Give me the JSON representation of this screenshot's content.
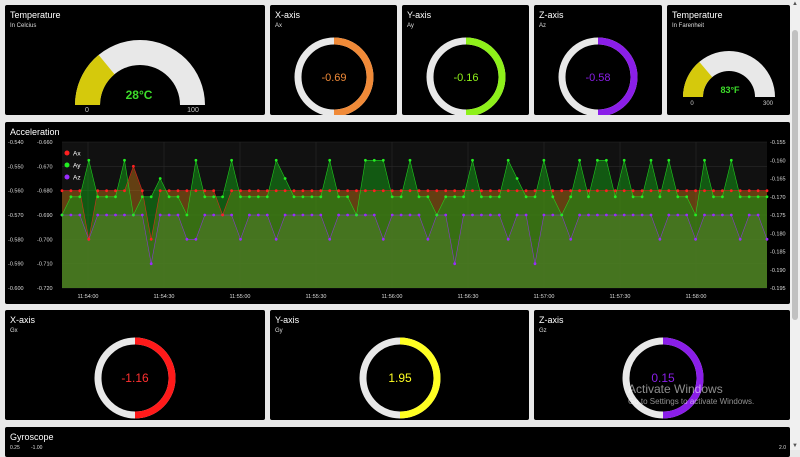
{
  "gauges": {
    "temp_c": {
      "title": "Temperature",
      "subtitle": "In Celcius",
      "value_text": "28°C",
      "min": "0",
      "max": "100",
      "value": 28,
      "range": [
        0,
        100
      ],
      "color": "#d5c90c",
      "value_color": "#3ddc2a"
    },
    "ax": {
      "title": "X-axis",
      "subtitle": "Ax",
      "value_text": "-0.69",
      "color": "#f08a38"
    },
    "ay": {
      "title": "Y-axis",
      "subtitle": "Ay",
      "value_text": "-0.16",
      "color": "#8ef01a"
    },
    "az": {
      "title": "Z-axis",
      "subtitle": "Az",
      "value_text": "-0.58",
      "color": "#8a1ee8"
    },
    "temp_f": {
      "title": "Temperature",
      "subtitle": "In Farenheit",
      "value_text": "83°F",
      "min": "0",
      "max": "300",
      "value": 83,
      "range": [
        0,
        300
      ],
      "color": "#d5c90c",
      "value_color": "#3ddc2a"
    },
    "gx": {
      "title": "X-axis",
      "subtitle": "Gx",
      "value_text": "-1.16",
      "color": "#ff1a1a"
    },
    "gy": {
      "title": "Y-axis",
      "subtitle": "Gy",
      "value_text": "1.95",
      "color": "#ffff22"
    },
    "gz": {
      "title": "Z-axis",
      "subtitle": "Gz",
      "value_text": "0.15",
      "color": "#8a1ee8"
    }
  },
  "chart_data": {
    "type": "area",
    "title": "Acceleration",
    "x_ticks": [
      "11:54:00",
      "11:54:30",
      "11:55:00",
      "11:55:30",
      "11:56:00",
      "11:56:30",
      "11:57:00",
      "11:57:30",
      "11:58:00"
    ],
    "y_left_outer_ticks": [
      "-0.540",
      "-0.550",
      "-0.560",
      "-0.570",
      "-0.580",
      "-0.590",
      "-0.600"
    ],
    "y_left_inner_ticks": [
      "-0.660",
      "-0.670",
      "-0.680",
      "-0.690",
      "-0.700",
      "-0.710",
      "-0.720"
    ],
    "y_right_ticks": [
      "-0.155",
      "-0.160",
      "-0.165",
      "-0.170",
      "-0.175",
      "-0.180",
      "-0.185",
      "-0.190",
      "-0.195"
    ],
    "ylim_ax": [
      -0.72,
      -0.66
    ],
    "ylim_az": [
      -0.6,
      -0.54
    ],
    "ylim_ay": [
      -0.195,
      -0.155
    ],
    "series": [
      {
        "name": "Ax",
        "color": "#ff2020",
        "fill": "rgba(200,120,20,0.45)",
        "values": [
          -0.68,
          -0.68,
          -0.68,
          -0.7,
          -0.68,
          -0.68,
          -0.68,
          -0.68,
          -0.67,
          -0.68,
          -0.7,
          -0.68,
          -0.68,
          -0.68,
          -0.68,
          -0.68,
          -0.68,
          -0.68,
          -0.69,
          -0.68,
          -0.68,
          -0.68,
          -0.68,
          -0.68,
          -0.68,
          -0.68,
          -0.68,
          -0.68,
          -0.68,
          -0.68,
          -0.68,
          -0.68,
          -0.68,
          -0.68,
          -0.68,
          -0.68,
          -0.68,
          -0.68,
          -0.68,
          -0.68,
          -0.68,
          -0.68,
          -0.68,
          -0.68,
          -0.68,
          -0.68,
          -0.68,
          -0.68,
          -0.68,
          -0.68,
          -0.68,
          -0.68,
          -0.68,
          -0.68,
          -0.68,
          -0.68,
          -0.68,
          -0.68,
          -0.68,
          -0.68,
          -0.68,
          -0.68,
          -0.68,
          -0.68,
          -0.68,
          -0.68,
          -0.68,
          -0.68,
          -0.68,
          -0.68,
          -0.68,
          -0.68,
          -0.68,
          -0.68,
          -0.68,
          -0.68,
          -0.68,
          -0.68,
          -0.68,
          -0.68
        ]
      },
      {
        "name": "Ay",
        "color": "#22ee22",
        "fill": "rgba(20,150,20,0.55)",
        "values": [
          -0.175,
          -0.17,
          -0.17,
          -0.16,
          -0.17,
          -0.17,
          -0.17,
          -0.16,
          -0.175,
          -0.17,
          -0.17,
          -0.165,
          -0.17,
          -0.17,
          -0.175,
          -0.16,
          -0.17,
          -0.17,
          -0.17,
          -0.16,
          -0.17,
          -0.17,
          -0.17,
          -0.17,
          -0.16,
          -0.165,
          -0.17,
          -0.17,
          -0.17,
          -0.17,
          -0.16,
          -0.17,
          -0.17,
          -0.175,
          -0.16,
          -0.16,
          -0.16,
          -0.17,
          -0.17,
          -0.16,
          -0.17,
          -0.17,
          -0.175,
          -0.17,
          -0.17,
          -0.17,
          -0.16,
          -0.17,
          -0.17,
          -0.17,
          -0.16,
          -0.165,
          -0.17,
          -0.17,
          -0.16,
          -0.17,
          -0.175,
          -0.17,
          -0.16,
          -0.17,
          -0.16,
          -0.16,
          -0.17,
          -0.16,
          -0.17,
          -0.17,
          -0.16,
          -0.17,
          -0.16,
          -0.17,
          -0.17,
          -0.175,
          -0.16,
          -0.17,
          -0.17,
          -0.16,
          -0.17,
          -0.17,
          -0.17,
          -0.17
        ]
      },
      {
        "name": "Az",
        "color": "#9a2cff",
        "fill": "rgba(120,60,110,0.55)",
        "values": [
          -0.57,
          -0.57,
          -0.57,
          -0.58,
          -0.57,
          -0.57,
          -0.57,
          -0.57,
          -0.57,
          -0.57,
          -0.59,
          -0.57,
          -0.57,
          -0.57,
          -0.58,
          -0.58,
          -0.57,
          -0.57,
          -0.57,
          -0.57,
          -0.58,
          -0.57,
          -0.57,
          -0.57,
          -0.58,
          -0.57,
          -0.57,
          -0.57,
          -0.57,
          -0.57,
          -0.58,
          -0.57,
          -0.57,
          -0.57,
          -0.57,
          -0.57,
          -0.58,
          -0.57,
          -0.57,
          -0.57,
          -0.57,
          -0.58,
          -0.57,
          -0.57,
          -0.59,
          -0.57,
          -0.57,
          -0.57,
          -0.57,
          -0.57,
          -0.58,
          -0.57,
          -0.57,
          -0.59,
          -0.57,
          -0.57,
          -0.57,
          -0.58,
          -0.57,
          -0.57,
          -0.57,
          -0.57,
          -0.57,
          -0.57,
          -0.57,
          -0.57,
          -0.57,
          -0.58,
          -0.57,
          -0.57,
          -0.57,
          -0.58,
          -0.57,
          -0.57,
          -0.57,
          -0.57,
          -0.58,
          -0.57,
          -0.57,
          -0.58
        ]
      }
    ],
    "legend_position": "top-left",
    "grid": true
  },
  "gyroscope": {
    "title": "Gyroscope",
    "tick_left": "0.25",
    "tick_left2": "-1.00",
    "tick_right": "2.0"
  },
  "overlay": {
    "line1": "Activate Windows",
    "line2": "Go to Settings to activate Windows."
  }
}
